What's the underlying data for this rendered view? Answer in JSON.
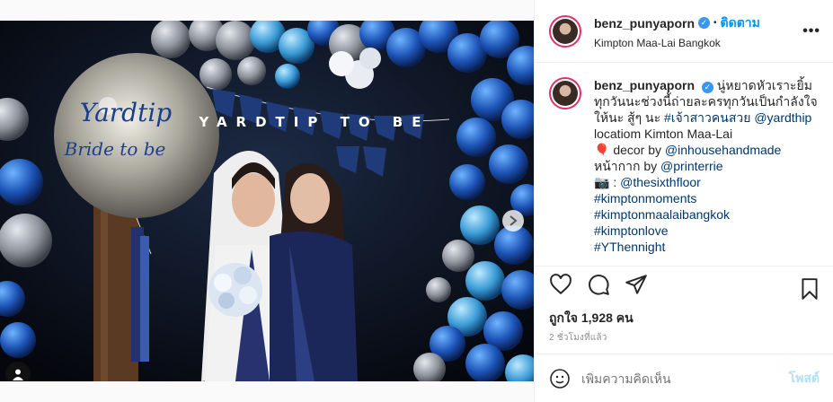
{
  "post": {
    "username": "benz_punyaporn",
    "verified_mark": "✓",
    "follow_label": "ติดตาม",
    "location": "Kimpton Maa-Lai Bangkok",
    "more_label": "•••",
    "caption_lines": [
      "นู่หยาดหัวเราะยิ้ม",
      "ทุกวันนะช่วงนี้ถ่ายละครทุกวันเป็นกำลังใจ",
      "ให้นะ สู้ๆ นะ"
    ],
    "caption_tag_1": "#เจ้าสาวคนสวย",
    "caption_mention_1": "@yardthip",
    "caption_location_line": "locatiom Kimton Maa-Lai",
    "decor_prefix": "🎈 decor by",
    "decor_mention": "@inhousehandmade",
    "mask_prefix": "หน้ากาก by",
    "mask_mention": "@printerrie",
    "camera_prefix": "📷 :",
    "camera_mention": "@thesixthfloor",
    "hashtags": [
      "#kimptonmoments",
      "#kimptonmaalaibangkok",
      "#kimptonlove",
      "#YThennight"
    ],
    "likes_label": "ถูกใจ 1,928 คน",
    "time_label": "2 ชั่วโมงที่แล้ว",
    "comment_placeholder": "เพิ่มความคิดเห็น",
    "post_label": "โพสต์"
  },
  "image": {
    "balloon_text_1": "Yardtip",
    "balloon_text_2": "Bride to be",
    "banner_text": "YARDTIP TO BE"
  },
  "colors": {
    "accent": "#0095f6",
    "link": "#00376b",
    "muted": "#8e8e8e"
  },
  "icons": [
    "heart-icon",
    "comment-icon",
    "share-icon",
    "bookmark-icon",
    "emoji-icon",
    "chevron-right-icon",
    "user-tag-icon",
    "more-icon"
  ]
}
